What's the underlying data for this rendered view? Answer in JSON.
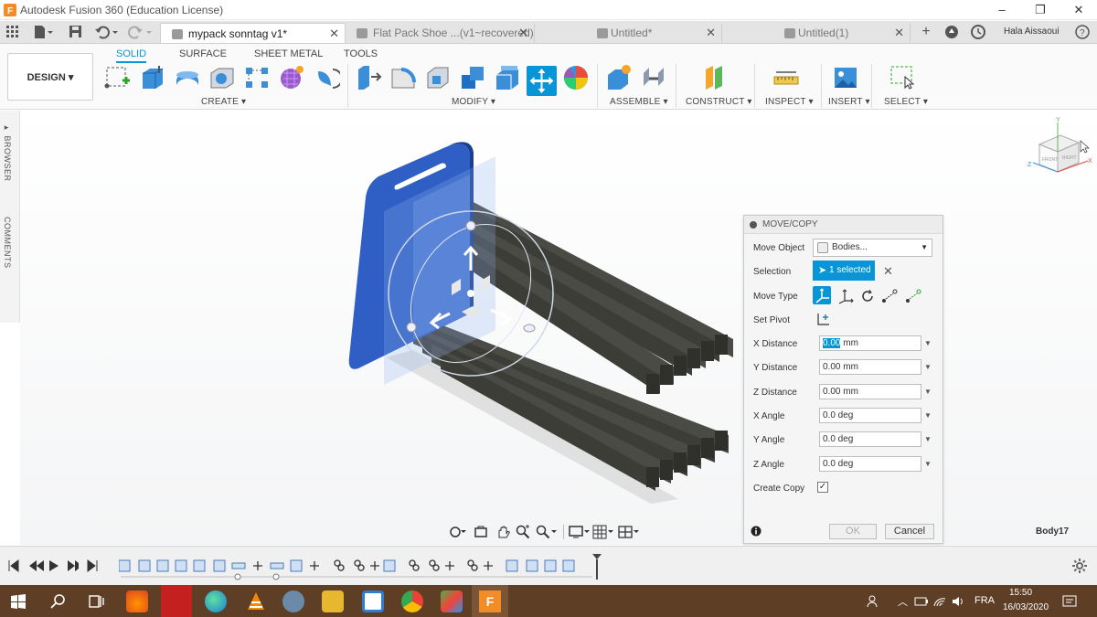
{
  "window": {
    "title": "Autodesk Fusion 360 (Education License)",
    "user": "Hala Aissaoui"
  },
  "tabs": [
    {
      "label": "mypack sonntag v1*",
      "active": true
    },
    {
      "label": "Flat Pack Shoe ...(v1~recovered)*",
      "active": false
    },
    {
      "label": "Untitled*",
      "active": false
    },
    {
      "label": "Untitled(1)",
      "active": false
    }
  ],
  "workspace": {
    "design_label": "DESIGN",
    "tabs": [
      "SOLID",
      "SURFACE",
      "SHEET METAL",
      "TOOLS"
    ],
    "active_tab": "SOLID"
  },
  "toolbar_groups": {
    "create": "CREATE",
    "modify": "MODIFY",
    "assemble": "ASSEMBLE",
    "construct": "CONSTRUCT",
    "inspect": "INSPECT",
    "insert": "INSERT",
    "select": "SELECT"
  },
  "left_panel": {
    "browser": "BROWSER",
    "comments": "COMMENTS"
  },
  "viewcube": {
    "front": "FRONT",
    "right": "RIGHT",
    "axis_x": "X",
    "axis_y": "Y",
    "axis_z": "Z"
  },
  "dialog": {
    "title": "MOVE/COPY",
    "move_object_label": "Move Object",
    "move_object_value": "Bodies...",
    "selection_label": "Selection",
    "selection_value": "1 selected",
    "move_type_label": "Move Type",
    "set_pivot_label": "Set Pivot",
    "fields": [
      {
        "label": "X Distance",
        "value": "0.00",
        "unit": "mm"
      },
      {
        "label": "Y Distance",
        "value": "0.00 mm"
      },
      {
        "label": "Z Distance",
        "value": "0.00 mm"
      },
      {
        "label": "X Angle",
        "value": "0.0 deg"
      },
      {
        "label": "Y Angle",
        "value": "0.0 deg"
      },
      {
        "label": "Z Angle",
        "value": "0.0 deg"
      }
    ],
    "create_copy_label": "Create Copy",
    "create_copy_checked": true,
    "ok_label": "OK",
    "cancel_label": "Cancel"
  },
  "status": {
    "selected_body": "Body17"
  },
  "taskbar": {
    "language": "FRA",
    "time": "15:50",
    "date": "16/03/2020"
  },
  "colors": {
    "accent": "#0696d7",
    "panel_blue": "#2f5fc4",
    "taskbar": "#5e3f26"
  }
}
